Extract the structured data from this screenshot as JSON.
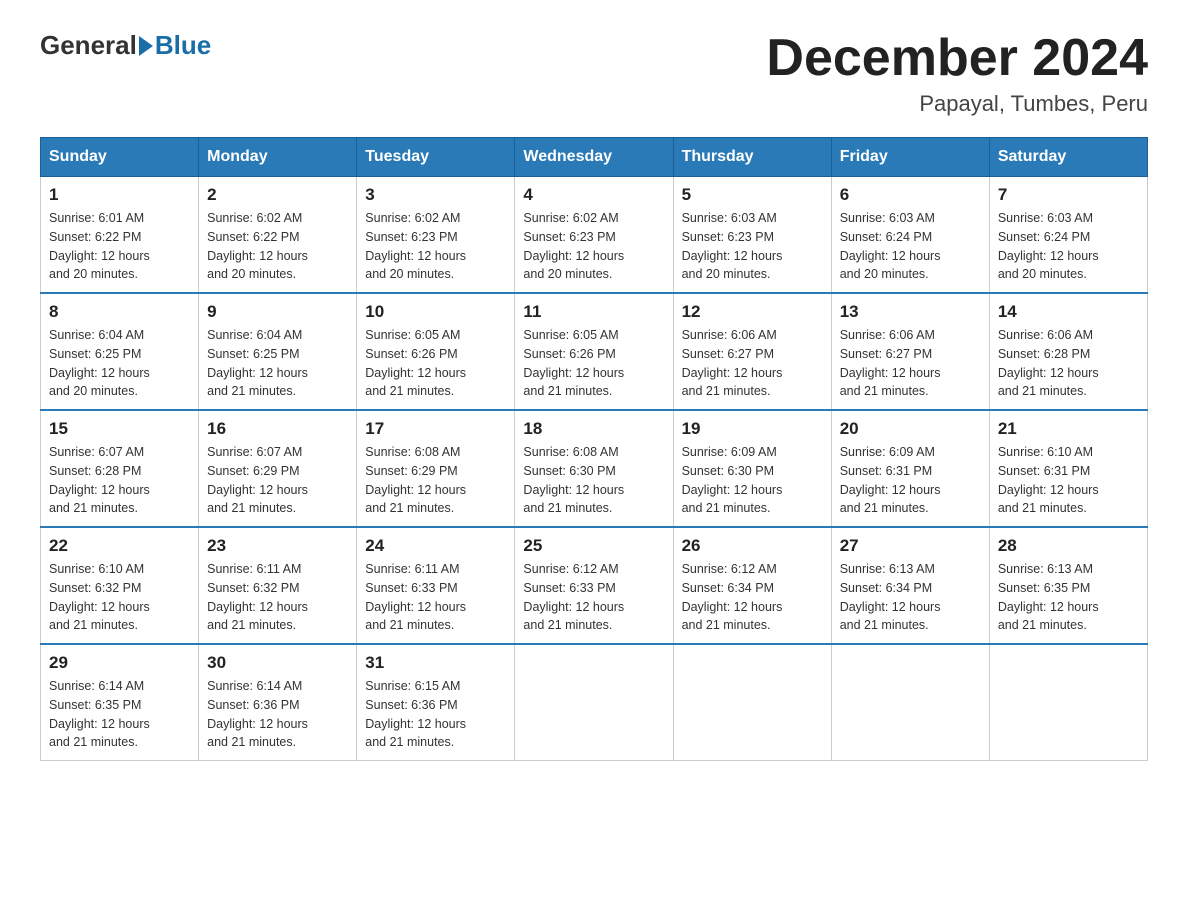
{
  "header": {
    "logo_general": "General",
    "logo_blue": "Blue",
    "month_title": "December 2024",
    "location": "Papayal, Tumbes, Peru"
  },
  "days_of_week": [
    "Sunday",
    "Monday",
    "Tuesday",
    "Wednesday",
    "Thursday",
    "Friday",
    "Saturday"
  ],
  "weeks": [
    [
      {
        "day": "1",
        "sunrise": "6:01 AM",
        "sunset": "6:22 PM",
        "daylight": "12 hours and 20 minutes."
      },
      {
        "day": "2",
        "sunrise": "6:02 AM",
        "sunset": "6:22 PM",
        "daylight": "12 hours and 20 minutes."
      },
      {
        "day": "3",
        "sunrise": "6:02 AM",
        "sunset": "6:23 PM",
        "daylight": "12 hours and 20 minutes."
      },
      {
        "day": "4",
        "sunrise": "6:02 AM",
        "sunset": "6:23 PM",
        "daylight": "12 hours and 20 minutes."
      },
      {
        "day": "5",
        "sunrise": "6:03 AM",
        "sunset": "6:23 PM",
        "daylight": "12 hours and 20 minutes."
      },
      {
        "day": "6",
        "sunrise": "6:03 AM",
        "sunset": "6:24 PM",
        "daylight": "12 hours and 20 minutes."
      },
      {
        "day": "7",
        "sunrise": "6:03 AM",
        "sunset": "6:24 PM",
        "daylight": "12 hours and 20 minutes."
      }
    ],
    [
      {
        "day": "8",
        "sunrise": "6:04 AM",
        "sunset": "6:25 PM",
        "daylight": "12 hours and 20 minutes."
      },
      {
        "day": "9",
        "sunrise": "6:04 AM",
        "sunset": "6:25 PM",
        "daylight": "12 hours and 21 minutes."
      },
      {
        "day": "10",
        "sunrise": "6:05 AM",
        "sunset": "6:26 PM",
        "daylight": "12 hours and 21 minutes."
      },
      {
        "day": "11",
        "sunrise": "6:05 AM",
        "sunset": "6:26 PM",
        "daylight": "12 hours and 21 minutes."
      },
      {
        "day": "12",
        "sunrise": "6:06 AM",
        "sunset": "6:27 PM",
        "daylight": "12 hours and 21 minutes."
      },
      {
        "day": "13",
        "sunrise": "6:06 AM",
        "sunset": "6:27 PM",
        "daylight": "12 hours and 21 minutes."
      },
      {
        "day": "14",
        "sunrise": "6:06 AM",
        "sunset": "6:28 PM",
        "daylight": "12 hours and 21 minutes."
      }
    ],
    [
      {
        "day": "15",
        "sunrise": "6:07 AM",
        "sunset": "6:28 PM",
        "daylight": "12 hours and 21 minutes."
      },
      {
        "day": "16",
        "sunrise": "6:07 AM",
        "sunset": "6:29 PM",
        "daylight": "12 hours and 21 minutes."
      },
      {
        "day": "17",
        "sunrise": "6:08 AM",
        "sunset": "6:29 PM",
        "daylight": "12 hours and 21 minutes."
      },
      {
        "day": "18",
        "sunrise": "6:08 AM",
        "sunset": "6:30 PM",
        "daylight": "12 hours and 21 minutes."
      },
      {
        "day": "19",
        "sunrise": "6:09 AM",
        "sunset": "6:30 PM",
        "daylight": "12 hours and 21 minutes."
      },
      {
        "day": "20",
        "sunrise": "6:09 AM",
        "sunset": "6:31 PM",
        "daylight": "12 hours and 21 minutes."
      },
      {
        "day": "21",
        "sunrise": "6:10 AM",
        "sunset": "6:31 PM",
        "daylight": "12 hours and 21 minutes."
      }
    ],
    [
      {
        "day": "22",
        "sunrise": "6:10 AM",
        "sunset": "6:32 PM",
        "daylight": "12 hours and 21 minutes."
      },
      {
        "day": "23",
        "sunrise": "6:11 AM",
        "sunset": "6:32 PM",
        "daylight": "12 hours and 21 minutes."
      },
      {
        "day": "24",
        "sunrise": "6:11 AM",
        "sunset": "6:33 PM",
        "daylight": "12 hours and 21 minutes."
      },
      {
        "day": "25",
        "sunrise": "6:12 AM",
        "sunset": "6:33 PM",
        "daylight": "12 hours and 21 minutes."
      },
      {
        "day": "26",
        "sunrise": "6:12 AM",
        "sunset": "6:34 PM",
        "daylight": "12 hours and 21 minutes."
      },
      {
        "day": "27",
        "sunrise": "6:13 AM",
        "sunset": "6:34 PM",
        "daylight": "12 hours and 21 minutes."
      },
      {
        "day": "28",
        "sunrise": "6:13 AM",
        "sunset": "6:35 PM",
        "daylight": "12 hours and 21 minutes."
      }
    ],
    [
      {
        "day": "29",
        "sunrise": "6:14 AM",
        "sunset": "6:35 PM",
        "daylight": "12 hours and 21 minutes."
      },
      {
        "day": "30",
        "sunrise": "6:14 AM",
        "sunset": "6:36 PM",
        "daylight": "12 hours and 21 minutes."
      },
      {
        "day": "31",
        "sunrise": "6:15 AM",
        "sunset": "6:36 PM",
        "daylight": "12 hours and 21 minutes."
      },
      null,
      null,
      null,
      null
    ]
  ],
  "labels": {
    "sunrise": "Sunrise:",
    "sunset": "Sunset:",
    "daylight": "Daylight:"
  }
}
